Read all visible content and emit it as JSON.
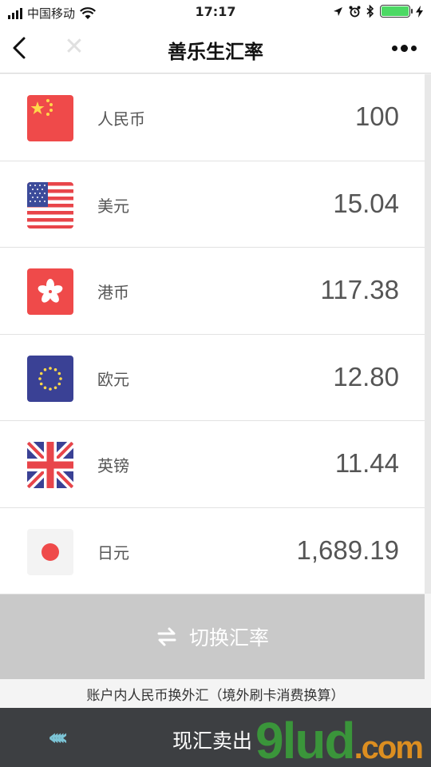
{
  "status_bar": {
    "carrier": "中国移动",
    "time": "17:17"
  },
  "nav": {
    "title": "善乐生汇率"
  },
  "currencies": [
    {
      "name": "人民币",
      "value": "100",
      "flag": "china-flag-icon"
    },
    {
      "name": "美元",
      "value": "15.04",
      "flag": "usa-flag-icon"
    },
    {
      "name": "港币",
      "value": "117.38",
      "flag": "hong-kong-flag-icon"
    },
    {
      "name": "欧元",
      "value": "12.80",
      "flag": "eu-flag-icon"
    },
    {
      "name": "英镑",
      "value": "11.44",
      "flag": "uk-flag-icon"
    },
    {
      "name": "日元",
      "value": "1,689.19",
      "flag": "japan-flag-icon"
    }
  ],
  "switch_button": {
    "label": "切换汇率",
    "icon": "swap-arrows-icon"
  },
  "note": "账户内人民币换外汇（境外刷卡消费换算）",
  "bottom_bar": {
    "label": "现汇卖出",
    "icon": "chevrons-left-icon"
  },
  "watermark": {
    "text": "9lud",
    "suffix": ".com"
  },
  "colors": {
    "accent_green": "#4cd964",
    "button_gray": "#c9c9c9",
    "bottom_bar": "#3d3f42"
  }
}
